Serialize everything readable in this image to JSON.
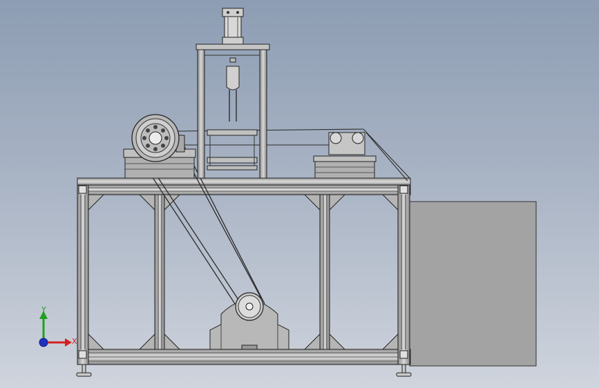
{
  "viewport": {
    "background_top": "#8d9db3",
    "background_bottom": "#cfd4dd"
  },
  "model": {
    "frame_color": "#bfbfbf",
    "edge_color": "#202020",
    "cabinet_color": "#a3a3a3"
  },
  "triad": {
    "x_label": "X",
    "y_label": "Y",
    "x_color": "#d42020",
    "y_color": "#20a020",
    "origin_color": "#2030c0"
  }
}
